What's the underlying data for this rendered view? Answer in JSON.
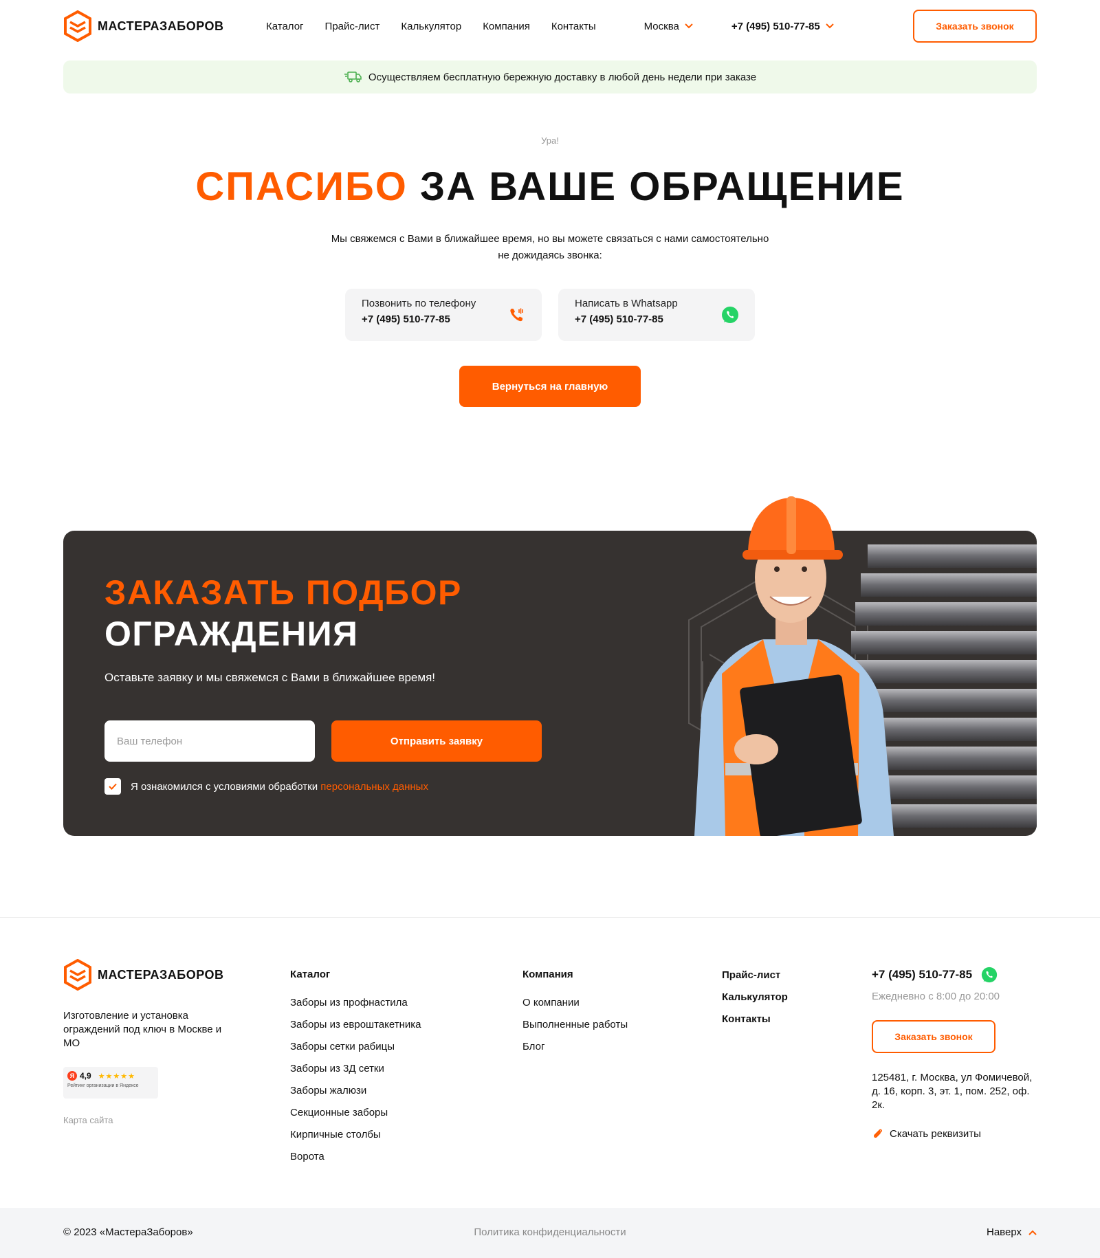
{
  "colors": {
    "accent": "#ff5c00",
    "dark_panel": "#363230",
    "banner_bg": "#eff9ea",
    "whatsapp": "#25d366"
  },
  "header": {
    "logo_text": "МАСТЕРАЗАБОРОВ",
    "nav": [
      "Каталог",
      "Прайс-лист",
      "Калькулятор",
      "Компания",
      "Контакты"
    ],
    "city": "Москва",
    "phone": "+7 (495) 510-77-85",
    "call_button": "Заказать звонок"
  },
  "banner": {
    "icon": "delivery-truck-icon",
    "text": "Осуществляем бесплатную бережную доставку в любой день недели при заказе"
  },
  "hero": {
    "kicker": "Ура!",
    "title_accent": "СПАСИБО",
    "title_rest": " ЗА ВАШЕ ОБРАЩЕНИЕ",
    "subtitle_line1": "Мы свяжемся с Вами в ближайшее время, но вы можете связаться с нами самостоятельно",
    "subtitle_line2": "не дожидаясь звонка:",
    "cards": [
      {
        "label": "Позвонить по телефону",
        "phone": "+7 (495) 510-77-85",
        "icon": "phone-call-icon"
      },
      {
        "label": "Написать в Whatsapp",
        "phone": "+7 (495) 510-77-85",
        "icon": "whatsapp-icon"
      }
    ],
    "back_button": "Вернуться на главную"
  },
  "promo": {
    "title_line1": "ЗАКАЗАТЬ ПОДБОР",
    "title_line2": "ОГРАЖДЕНИЯ",
    "subtitle": "Оставьте заявку и мы свяжемся с Вами в ближайшее время!",
    "phone_placeholder": "Ваш телефон",
    "phone_value": "",
    "submit": "Отправить заявку",
    "consent_text": "Я ознакомился с условиями обработки ",
    "consent_link": "персональных данных",
    "consent_checked": true
  },
  "footer": {
    "logo_text": "МАСТЕРАЗАБОРОВ",
    "description": "Изготовление и установка ограждений под ключ в Москве и МО",
    "rating": {
      "score": "4,9",
      "stars": 5,
      "caption": "Рейтинг организации в Яндексе"
    },
    "sitemap": "Карта сайта",
    "catalog": {
      "title": "Каталог",
      "items": [
        "Заборы из профнастила",
        "Заборы из евроштакетника",
        "Заборы сетки рабицы",
        "Заборы из 3Д сетки",
        "Заборы жалюзи",
        "Секционные заборы",
        "Кирпичные столбы",
        "Ворота"
      ]
    },
    "company": {
      "title": "Компания",
      "items": [
        "О компании",
        "Выполненные работы",
        "Блог"
      ]
    },
    "extra_links": [
      "Прайс-лист",
      "Калькулятор",
      "Контакты"
    ],
    "phone": "+7 (495) 510-77-85",
    "hours": "Ежедневно с 8:00 до 20:00",
    "call_button": "Заказать звонок",
    "address": "125481, г. Москва, ул Фомичевой, д. 16, корп. 3, эт. 1, пом. 252, оф. 2к.",
    "download": "Скачать реквизиты",
    "copyright": "© 2023 «МастераЗаборов»",
    "policy": "Политика конфиденциальности",
    "to_top": "Наверх"
  }
}
